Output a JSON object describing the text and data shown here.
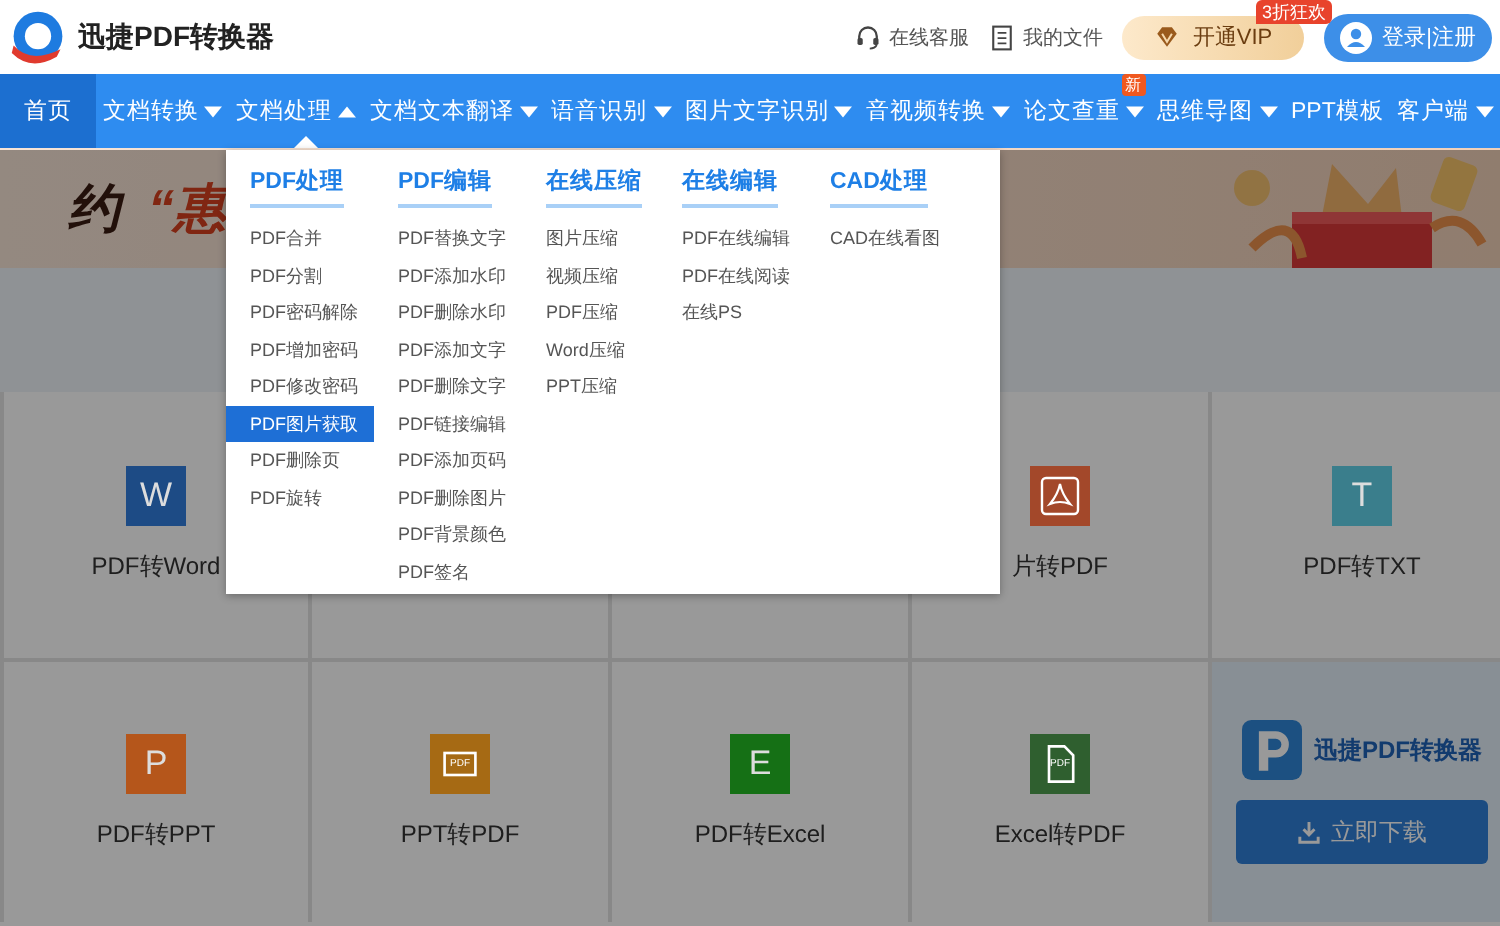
{
  "header": {
    "logo_text": "迅捷PDF转换器",
    "links": [
      {
        "label": "在线客服",
        "kind": "headset"
      },
      {
        "label": "我的文件",
        "kind": "file"
      }
    ],
    "vip_button": {
      "label": "开通VIP",
      "badge": "3折狂欢"
    },
    "login_button": {
      "label": "登录|注册"
    }
  },
  "nav": [
    {
      "label": "首页",
      "selected": true,
      "has_menu": false,
      "expanded": false
    },
    {
      "label": "文档转换",
      "selected": false,
      "has_menu": true,
      "expanded": false
    },
    {
      "label": "文档处理",
      "selected": false,
      "has_menu": true,
      "expanded": true
    },
    {
      "label": "文档文本翻译",
      "selected": false,
      "has_menu": true,
      "expanded": false
    },
    {
      "label": "语音识别",
      "selected": false,
      "has_menu": true,
      "expanded": false
    },
    {
      "label": "图片文字识别",
      "selected": false,
      "has_menu": true,
      "expanded": false
    },
    {
      "label": "音视频转换",
      "selected": false,
      "has_menu": true,
      "expanded": false
    },
    {
      "label": "论文查重",
      "selected": false,
      "has_menu": true,
      "expanded": false,
      "badge": "新"
    },
    {
      "label": "思维导图",
      "selected": false,
      "has_menu": true,
      "expanded": false
    },
    {
      "label": "PPT模板",
      "selected": false,
      "has_menu": false,
      "expanded": false
    },
    {
      "label": "客户端",
      "selected": false,
      "has_menu": true,
      "expanded": false
    }
  ],
  "banner": {
    "title": [
      {
        "text": "约",
        "kind": "plain"
      },
      {
        "text": "“惠",
        "kind": "accent"
      }
    ]
  },
  "dropdown": {
    "columns": [
      {
        "heading": "PDF处理",
        "items": [
          {
            "label": "PDF合并",
            "selected": false
          },
          {
            "label": "PDF分割",
            "selected": false
          },
          {
            "label": "PDF密码解除",
            "selected": false
          },
          {
            "label": "PDF增加密码",
            "selected": false
          },
          {
            "label": "PDF修改密码",
            "selected": false
          },
          {
            "label": "PDF图片获取",
            "selected": true
          },
          {
            "label": "PDF删除页",
            "selected": false
          },
          {
            "label": "PDF旋转",
            "selected": false
          }
        ]
      },
      {
        "heading": "PDF编辑",
        "items": [
          {
            "label": "PDF替换文字",
            "selected": false
          },
          {
            "label": "PDF添加水印",
            "selected": false
          },
          {
            "label": "PDF删除水印",
            "selected": false
          },
          {
            "label": "PDF添加文字",
            "selected": false
          },
          {
            "label": "PDF删除文字",
            "selected": false
          },
          {
            "label": "PDF链接编辑",
            "selected": false
          },
          {
            "label": "PDF添加页码",
            "selected": false
          },
          {
            "label": "PDF删除图片",
            "selected": false
          },
          {
            "label": "PDF背景颜色",
            "selected": false
          },
          {
            "label": "PDF签名",
            "selected": false
          }
        ]
      },
      {
        "heading": "在线压缩",
        "items": [
          {
            "label": "图片压缩",
            "selected": false
          },
          {
            "label": "视频压缩",
            "selected": false
          },
          {
            "label": "PDF压缩",
            "selected": false
          },
          {
            "label": "Word压缩",
            "selected": false
          },
          {
            "label": "PPT压缩",
            "selected": false
          }
        ]
      },
      {
        "heading": "在线编辑",
        "items": [
          {
            "label": "PDF在线编辑",
            "selected": false
          },
          {
            "label": "PDF在线阅读",
            "selected": false
          },
          {
            "label": "在线PS",
            "selected": false
          }
        ]
      },
      {
        "heading": "CAD处理",
        "items": [
          {
            "label": "CAD在线看图",
            "selected": false
          }
        ]
      }
    ]
  },
  "tools": [
    {
      "kind": "letter",
      "label": "PDF转Word",
      "glyph": "W",
      "color": "#1d4b85"
    },
    {
      "kind": "covered"
    },
    {
      "kind": "covered"
    },
    {
      "kind": "acrobat",
      "label": "片转PDF",
      "color": "#a3482a"
    },
    {
      "kind": "letter",
      "label": "PDF转TXT",
      "glyph": "T",
      "color": "#3a7e8c"
    },
    {
      "kind": "letter",
      "label": "PDF转PPT",
      "glyph": "P",
      "color": "#b5561b"
    },
    {
      "kind": "slide-pdf",
      "label": "PPT转PDF",
      "glyph": "PDF",
      "color": "#a66a14"
    },
    {
      "kind": "letter",
      "label": "PDF转Excel",
      "glyph": "E",
      "color": "#157015"
    },
    {
      "kind": "doc-pdf",
      "label": "Excel转PDF",
      "glyph": "PDF",
      "color": "#2f5f2f"
    },
    {
      "kind": "promo",
      "brand": "迅捷PDF转换器",
      "button": "立即下载"
    }
  ]
}
